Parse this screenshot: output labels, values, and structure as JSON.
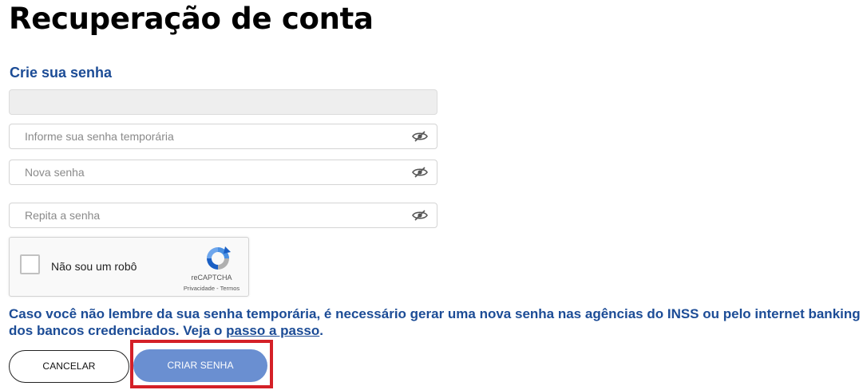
{
  "page": {
    "title": "Recuperação de conta",
    "section_title": "Crie sua senha"
  },
  "form": {
    "cpf_value": "",
    "temp_password": {
      "placeholder": "Informe sua senha temporária",
      "icon": "eye-slash-icon"
    },
    "new_password": {
      "placeholder": "Nova senha",
      "icon": "eye-slash-icon"
    },
    "repeat_password": {
      "placeholder": "Repita a senha",
      "icon": "eye-slash-icon"
    }
  },
  "captcha": {
    "label": "Não sou um robô",
    "brand": "reCAPTCHA",
    "privacy": "Privacidade",
    "separator": " - ",
    "terms": "Termos",
    "checked": false
  },
  "notice": {
    "text": "Caso você não lembre da sua senha temporária, é necessário gerar uma nova senha nas agências do INSS ou pelo internet banking dos bancos credenciados. Veja o ",
    "link": "passo a passo",
    "end": "."
  },
  "buttons": {
    "cancel": "CANCELAR",
    "create": "CRIAR SENHA"
  },
  "colors": {
    "accent": "#1c4c96",
    "primary_button": "#6a8fd1",
    "highlight": "#d42027"
  }
}
